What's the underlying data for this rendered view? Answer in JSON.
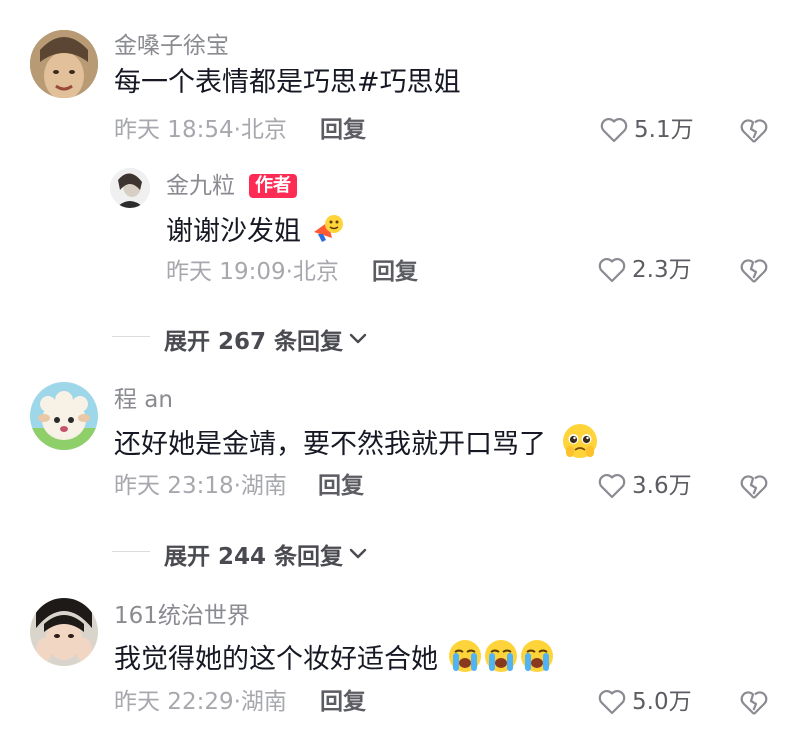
{
  "comments": [
    {
      "author": "金嗓子徐宝",
      "text": "每一个表情都是巧思#巧思姐",
      "time": "昨天 18:54·北京",
      "reply_label": "回复",
      "likes": "5.1万",
      "avatar_icon": "avatar-photo-icon",
      "replies": [
        {
          "author": "金九粒",
          "badge": "作者",
          "text": "谢谢沙发姐",
          "emoji": "megaphone-emoji-icon",
          "time": "昨天 19:09·北京",
          "reply_label": "回复",
          "likes": "2.3万",
          "avatar_icon": "avatar-photo-icon"
        }
      ],
      "expand_label": "展开 267 条回复"
    },
    {
      "author": "程 an",
      "text": "还好她是金靖，要不然我就开口骂了",
      "emoji": "pleading-face-emoji-icon",
      "time": "昨天 23:18·湖南",
      "reply_label": "回复",
      "likes": "3.6万",
      "avatar_icon": "avatar-cartoon-sheep-icon",
      "expand_label": "展开 244 条回复"
    },
    {
      "author": "161统治世界",
      "text": "我觉得她的这个妆好适合她",
      "emoji": "loudly-crying-face-emoji-icon",
      "emoji_count": 3,
      "time": "昨天 22:29·湖南",
      "reply_label": "回复",
      "likes": "5.0万",
      "avatar_icon": "avatar-photo-icon"
    }
  ],
  "colors": {
    "accent_badge": "#fe2c55",
    "text_primary": "#161823",
    "text_secondary": "#8a8b91"
  }
}
